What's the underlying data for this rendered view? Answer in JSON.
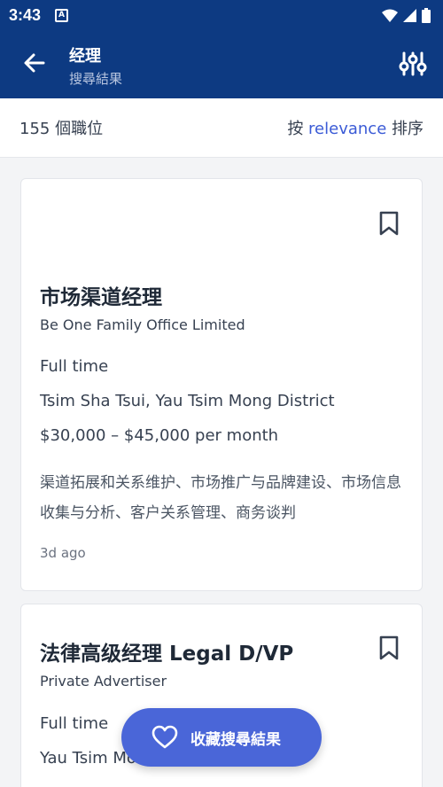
{
  "status_bar": {
    "time": "3:43",
    "app_indicator": "A",
    "icons": [
      "wifi-icon",
      "signal-icon",
      "battery-icon"
    ]
  },
  "app_bar": {
    "title": "经理",
    "subtitle": "搜尋結果",
    "back_icon": "arrow-left-icon",
    "filter_icon": "sliders-icon"
  },
  "results": {
    "count_label": "155 個職位",
    "sort_prefix": "按",
    "sort_key": "relevance",
    "sort_suffix": "排序"
  },
  "jobs": [
    {
      "title": "市场渠道经理",
      "company": "Be One Family Office Limited",
      "work_type": "Full time",
      "location": "Tsim Sha Tsui, Yau Tsim Mong District",
      "salary": "$30,000 – $45,000 per month",
      "teaser": "渠道拓展和关系维护、市场推广与品牌建设、市场信息收集与分析、客户关系管理、商务谈判",
      "posted": "3d ago"
    },
    {
      "title": "法律高级经理 Legal D/VP",
      "company": "Private Advertiser",
      "work_type": "Full time",
      "location": "Yau Tsim Mong"
    }
  ],
  "save_search": {
    "label": "收藏搜尋結果",
    "icon": "heart-icon"
  },
  "colors": {
    "header_bg": "#0d3a82",
    "accent": "#3b5bd6",
    "fab_bg": "#4a66d8"
  }
}
